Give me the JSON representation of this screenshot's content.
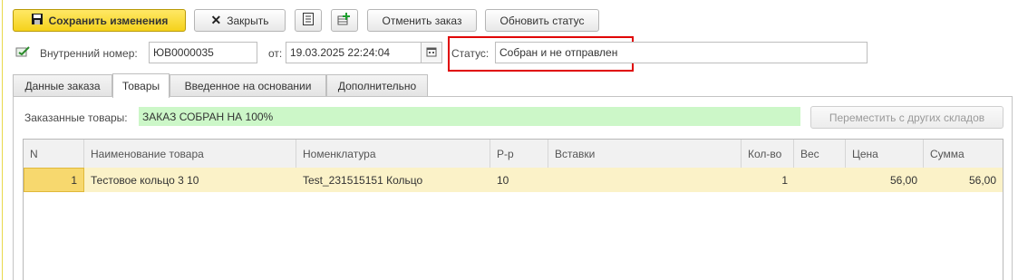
{
  "toolbar": {
    "save_label": "Сохранить изменения",
    "close_label": "Закрыть",
    "cancel_order_label": "Отменить заказ",
    "update_status_label": "Обновить статус"
  },
  "header": {
    "internal_number_label": "Внутренний номер:",
    "internal_number_value": "ЮВ0000035",
    "date_label": "от:",
    "date_value": "19.03.2025 22:24:04",
    "status_label": "Статус:",
    "status_value": "Собран и не отправлен"
  },
  "tabs": [
    {
      "label": "Данные заказа"
    },
    {
      "label": "Товары"
    },
    {
      "label": "Введенное на основании"
    },
    {
      "label": "Дополнительно"
    }
  ],
  "goods": {
    "ordered_label": "Заказанные товары:",
    "ordered_status": "ЗАКАЗ СОБРАН НА 100%",
    "move_button_label": "Переместить с других складов"
  },
  "table": {
    "columns": [
      "N",
      "Наименование товара",
      "Номенклатура",
      "Р-р",
      "Вставки",
      "Кол-во",
      "Вес",
      "Цена",
      "Сумма"
    ],
    "rows": [
      {
        "n": "1",
        "name": "Тестовое кольцо 3 10",
        "nomenclature": "Test_231515151 Кольцо",
        "size": "10",
        "inserts": "",
        "qty": "1",
        "weight": "",
        "price": "56,00",
        "sum": "56,00"
      }
    ]
  },
  "colors": {
    "primary_button": "#f5d21b",
    "status_highlight": "#e00000",
    "ordered_bg": "#ccf7c8",
    "selected_row": "#fbf2c8"
  }
}
